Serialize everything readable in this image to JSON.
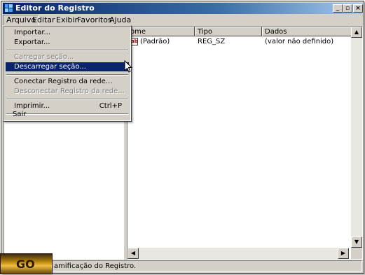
{
  "window": {
    "title": "Editor do Registro"
  },
  "titlebar_buttons": {
    "minimize": "_",
    "maximize": "▫",
    "close": "×"
  },
  "menubar": [
    {
      "label": "Arquivo"
    },
    {
      "label": "Editar"
    },
    {
      "label": "Exibir"
    },
    {
      "label": "Favoritos"
    },
    {
      "label": "Ajuda"
    }
  ],
  "file_menu": {
    "import": "Importar...",
    "export": "Exportar...",
    "load_hive": "Carregar seção...",
    "unload_hive": "Descarregar seção...",
    "connect_network": "Conectar Registro da rede...",
    "disconnect_network": "Desconectar Registro da rede...",
    "print": "Imprimir...",
    "print_shortcut": "Ctrl+P",
    "exit": "Sair"
  },
  "list": {
    "headers": {
      "name": "ome",
      "type": "Tipo",
      "data": "Dados"
    },
    "rows": [
      {
        "name": "(Padrão)",
        "type": "REG_SZ",
        "data": "(valor não definido)"
      }
    ]
  },
  "status": {
    "text": "amificação do Registro."
  },
  "logo": {
    "text": "GO"
  },
  "colors": {
    "titlebar": "#0a246a",
    "highlight": "#0a246a",
    "face": "#d4d0c8"
  }
}
